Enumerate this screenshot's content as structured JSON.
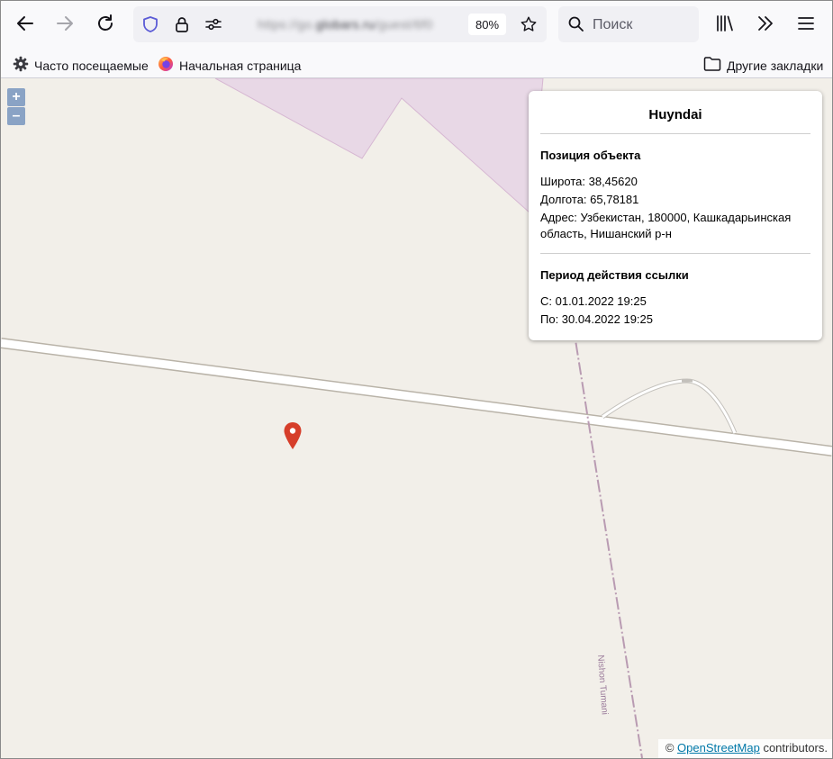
{
  "browser": {
    "url_host_text": "https://go.",
    "url_domain": "globars.ru",
    "url_path": "/guest/6f0",
    "zoom_level": "80%",
    "search_placeholder": "Поиск"
  },
  "bookmarks": {
    "most_visited": "Часто посещаемые",
    "home_page": "Начальная страница",
    "other_bookmarks": "Другие закладки"
  },
  "map": {
    "zoom_in": "+",
    "zoom_out": "–",
    "road_label": "Nishon Tumani",
    "attribution_prefix": "©",
    "attribution_link": "OpenStreetMap",
    "attribution_suffix": "contributors.",
    "popup": {
      "title": "Huyndai",
      "position_heading": "Позиция объекта",
      "latitude": "Широта: 38,45620",
      "longitude": "Долгота: 65,78181",
      "address": "Адрес: Узбекистан, 180000, Кашкадарьинская область, Нишанский р-н",
      "period_heading": "Период действия ссылки",
      "from": "С: 01.01.2022 19:25",
      "to": "По: 30.04.2022 19:25"
    }
  },
  "colors": {
    "land": "#f2efe9",
    "military_area": "#e8d8e6",
    "marker": "#d63e2a",
    "zoom_button": "#8aa3c5",
    "accent_shield": "#5b5bd6"
  },
  "icons": [
    "back-arrow-icon",
    "forward-arrow-icon",
    "reload-icon",
    "tracking-shield-icon",
    "lock-icon",
    "permissions-icon",
    "bookmark-star-icon",
    "search-icon",
    "library-icon",
    "overflow-chevron-icon",
    "hamburger-menu-icon",
    "gear-icon",
    "firefox-icon",
    "folder-icon",
    "map-marker-icon"
  ]
}
